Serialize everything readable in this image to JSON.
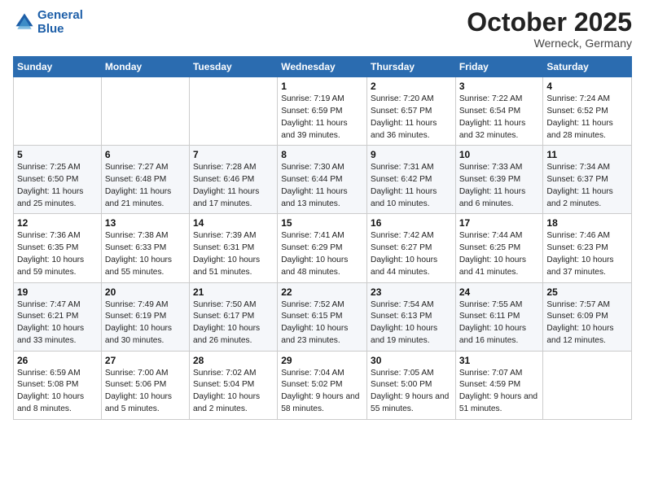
{
  "header": {
    "logo_line1": "General",
    "logo_line2": "Blue",
    "month": "October 2025",
    "location": "Werneck, Germany"
  },
  "days_of_week": [
    "Sunday",
    "Monday",
    "Tuesday",
    "Wednesday",
    "Thursday",
    "Friday",
    "Saturday"
  ],
  "weeks": [
    [
      {
        "num": "",
        "info": ""
      },
      {
        "num": "",
        "info": ""
      },
      {
        "num": "",
        "info": ""
      },
      {
        "num": "1",
        "info": "Sunrise: 7:19 AM\nSunset: 6:59 PM\nDaylight: 11 hours and 39 minutes."
      },
      {
        "num": "2",
        "info": "Sunrise: 7:20 AM\nSunset: 6:57 PM\nDaylight: 11 hours and 36 minutes."
      },
      {
        "num": "3",
        "info": "Sunrise: 7:22 AM\nSunset: 6:54 PM\nDaylight: 11 hours and 32 minutes."
      },
      {
        "num": "4",
        "info": "Sunrise: 7:24 AM\nSunset: 6:52 PM\nDaylight: 11 hours and 28 minutes."
      }
    ],
    [
      {
        "num": "5",
        "info": "Sunrise: 7:25 AM\nSunset: 6:50 PM\nDaylight: 11 hours and 25 minutes."
      },
      {
        "num": "6",
        "info": "Sunrise: 7:27 AM\nSunset: 6:48 PM\nDaylight: 11 hours and 21 minutes."
      },
      {
        "num": "7",
        "info": "Sunrise: 7:28 AM\nSunset: 6:46 PM\nDaylight: 11 hours and 17 minutes."
      },
      {
        "num": "8",
        "info": "Sunrise: 7:30 AM\nSunset: 6:44 PM\nDaylight: 11 hours and 13 minutes."
      },
      {
        "num": "9",
        "info": "Sunrise: 7:31 AM\nSunset: 6:42 PM\nDaylight: 11 hours and 10 minutes."
      },
      {
        "num": "10",
        "info": "Sunrise: 7:33 AM\nSunset: 6:39 PM\nDaylight: 11 hours and 6 minutes."
      },
      {
        "num": "11",
        "info": "Sunrise: 7:34 AM\nSunset: 6:37 PM\nDaylight: 11 hours and 2 minutes."
      }
    ],
    [
      {
        "num": "12",
        "info": "Sunrise: 7:36 AM\nSunset: 6:35 PM\nDaylight: 10 hours and 59 minutes."
      },
      {
        "num": "13",
        "info": "Sunrise: 7:38 AM\nSunset: 6:33 PM\nDaylight: 10 hours and 55 minutes."
      },
      {
        "num": "14",
        "info": "Sunrise: 7:39 AM\nSunset: 6:31 PM\nDaylight: 10 hours and 51 minutes."
      },
      {
        "num": "15",
        "info": "Sunrise: 7:41 AM\nSunset: 6:29 PM\nDaylight: 10 hours and 48 minutes."
      },
      {
        "num": "16",
        "info": "Sunrise: 7:42 AM\nSunset: 6:27 PM\nDaylight: 10 hours and 44 minutes."
      },
      {
        "num": "17",
        "info": "Sunrise: 7:44 AM\nSunset: 6:25 PM\nDaylight: 10 hours and 41 minutes."
      },
      {
        "num": "18",
        "info": "Sunrise: 7:46 AM\nSunset: 6:23 PM\nDaylight: 10 hours and 37 minutes."
      }
    ],
    [
      {
        "num": "19",
        "info": "Sunrise: 7:47 AM\nSunset: 6:21 PM\nDaylight: 10 hours and 33 minutes."
      },
      {
        "num": "20",
        "info": "Sunrise: 7:49 AM\nSunset: 6:19 PM\nDaylight: 10 hours and 30 minutes."
      },
      {
        "num": "21",
        "info": "Sunrise: 7:50 AM\nSunset: 6:17 PM\nDaylight: 10 hours and 26 minutes."
      },
      {
        "num": "22",
        "info": "Sunrise: 7:52 AM\nSunset: 6:15 PM\nDaylight: 10 hours and 23 minutes."
      },
      {
        "num": "23",
        "info": "Sunrise: 7:54 AM\nSunset: 6:13 PM\nDaylight: 10 hours and 19 minutes."
      },
      {
        "num": "24",
        "info": "Sunrise: 7:55 AM\nSunset: 6:11 PM\nDaylight: 10 hours and 16 minutes."
      },
      {
        "num": "25",
        "info": "Sunrise: 7:57 AM\nSunset: 6:09 PM\nDaylight: 10 hours and 12 minutes."
      }
    ],
    [
      {
        "num": "26",
        "info": "Sunrise: 6:59 AM\nSunset: 5:08 PM\nDaylight: 10 hours and 8 minutes."
      },
      {
        "num": "27",
        "info": "Sunrise: 7:00 AM\nSunset: 5:06 PM\nDaylight: 10 hours and 5 minutes."
      },
      {
        "num": "28",
        "info": "Sunrise: 7:02 AM\nSunset: 5:04 PM\nDaylight: 10 hours and 2 minutes."
      },
      {
        "num": "29",
        "info": "Sunrise: 7:04 AM\nSunset: 5:02 PM\nDaylight: 9 hours and 58 minutes."
      },
      {
        "num": "30",
        "info": "Sunrise: 7:05 AM\nSunset: 5:00 PM\nDaylight: 9 hours and 55 minutes."
      },
      {
        "num": "31",
        "info": "Sunrise: 7:07 AM\nSunset: 4:59 PM\nDaylight: 9 hours and 51 minutes."
      },
      {
        "num": "",
        "info": ""
      }
    ]
  ]
}
